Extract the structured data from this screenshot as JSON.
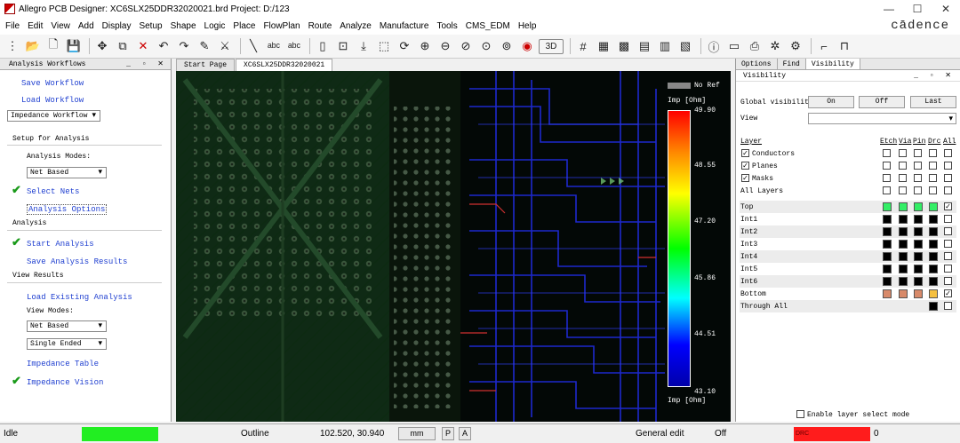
{
  "window": {
    "title": "Allegro PCB Designer: XC6SLX25DDR32020021.brd  Project: D:/123"
  },
  "menu": [
    "File",
    "Edit",
    "View",
    "Add",
    "Display",
    "Setup",
    "Shape",
    "Logic",
    "Place",
    "FlowPlan",
    "Route",
    "Analyze",
    "Manufacture",
    "Tools",
    "CMS_EDM",
    "Help"
  ],
  "brand": "cādence",
  "toolbar": {
    "view3d_label": "3D"
  },
  "left_panel": {
    "header": "Analysis Workflows",
    "save_workflow": "Save Workflow",
    "load_workflow": "Load Workflow",
    "workflow_select": "Impedance Workflow",
    "setup_heading": "Setup for Analysis",
    "analysis_modes_label": "Analysis Modes:",
    "analysis_mode_value": "Net Based",
    "select_nets": "Select Nets",
    "analysis_options": "Analysis Options",
    "analysis_heading": "Analysis",
    "start_analysis": "Start Analysis",
    "save_results": "Save Analysis Results",
    "view_results_heading": "View Results",
    "load_existing": "Load Existing Analysis",
    "view_modes_label": "View Modes:",
    "view_mode_value": "Net Based",
    "ended_value": "Single Ended",
    "impedance_table": "Impedance Table",
    "impedance_vision": "Impedance Vision"
  },
  "doc_tabs": [
    "Start Page",
    "XC6SLX25DDR32020021"
  ],
  "legend": {
    "no_ref": "No Ref",
    "unit_top": "Imp [Ohm]",
    "unit_bottom": "Imp [Ohm]",
    "ticks": [
      "49.90",
      "48.55",
      "47.20",
      "45.86",
      "44.51",
      "43.10"
    ]
  },
  "right_panel": {
    "tabs": [
      "Options",
      "Find",
      "Visibility"
    ],
    "sub_header": "Visibility",
    "global_visibility_label": "Global visibility",
    "btn_on": "On",
    "btn_off": "Off",
    "btn_last": "Last",
    "view_label": "View",
    "col_layer": "Layer",
    "col_etch": "Etch",
    "col_via": "Via",
    "col_pin": "Pin",
    "col_drc": "Drc",
    "col_all": "All",
    "groups": [
      "Conductors",
      "Planes",
      "Masks",
      "All Layers"
    ],
    "layers": [
      "Top",
      "Int1",
      "Int2",
      "Int3",
      "Int4",
      "Int5",
      "Int6",
      "Bottom",
      "Through All"
    ],
    "enable_select": "Enable layer select mode",
    "colors": {
      "top": "#33ee66",
      "bottom": "#d88a6a",
      "bottom_drc": "#f5c040",
      "inner": "#000000"
    }
  },
  "status": {
    "state": "Idle",
    "mode": "Outline",
    "coords": "102.520, 30.940",
    "unit": "mm",
    "p": "P",
    "a": "A",
    "edit_mode": "General edit",
    "off": "Off",
    "drc_count": "0",
    "drc_label": "DRC"
  }
}
